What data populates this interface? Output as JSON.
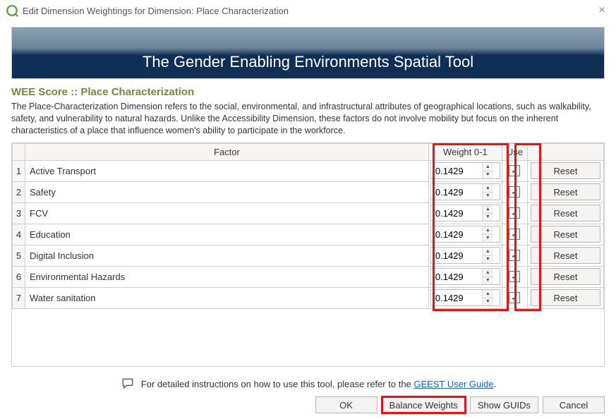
{
  "window": {
    "title": "Edit Dimension Weightings for Dimension: Place Characterization",
    "close_label": "×"
  },
  "banner": {
    "title": "The Gender Enabling Environments Spatial Tool"
  },
  "section": {
    "title": "WEE Score :: Place Characterization",
    "description": "The Place-Characterization Dimension refers to the social, environmental, and infrastructural attributes of geographical locations, such as walkability, safety, and vulnerability to natural hazards. Unlike the Accessibility Dimension, these factors do not involve mobility but focus on the inherent characteristics of a place that influence women's ability to participate in the workforce."
  },
  "table": {
    "headers": {
      "factor": "Factor",
      "weight": "Weight 0-1",
      "use": "Use",
      "reset": ""
    },
    "reset_label": "Reset",
    "rows": [
      {
        "n": "1",
        "factor": "Active Transport",
        "weight": "0.1429",
        "use": true
      },
      {
        "n": "2",
        "factor": "Safety",
        "weight": "0.1429",
        "use": true
      },
      {
        "n": "3",
        "factor": "FCV",
        "weight": "0.1429",
        "use": true
      },
      {
        "n": "4",
        "factor": "Education",
        "weight": "0.1429",
        "use": true
      },
      {
        "n": "5",
        "factor": "Digital Inclusion",
        "weight": "0.1429",
        "use": true
      },
      {
        "n": "6",
        "factor": "Environmental Hazards",
        "weight": "0.1429",
        "use": true
      },
      {
        "n": "7",
        "factor": "Water sanitation",
        "weight": "0.1429",
        "use": true
      }
    ]
  },
  "footer": {
    "info_text": "For detailed instructions on how to use this tool, please refer to the ",
    "link_text": "GEEST User Guide",
    "period": "."
  },
  "buttons": {
    "ok": "OK",
    "balance": "Balance Weights",
    "guids": "Show GUIDs",
    "cancel": "Cancel"
  },
  "colors": {
    "highlight": "#e11",
    "accent_green": "#6f8a3a",
    "banner_navy": "#0f2f56"
  }
}
